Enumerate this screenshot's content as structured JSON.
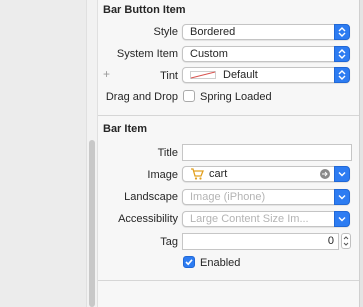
{
  "bar_button_item": {
    "title": "Bar Button Item",
    "style": {
      "label": "Style",
      "value": "Bordered"
    },
    "system_item": {
      "label": "System Item",
      "value": "Custom"
    },
    "tint": {
      "plus": "+",
      "label": "Tint",
      "value": "Default"
    },
    "drag_and_drop": {
      "label": "Drag and Drop",
      "option": "Spring Loaded",
      "checked": false
    }
  },
  "bar_item": {
    "title": "Bar Item",
    "title_field": {
      "label": "Title",
      "value": ""
    },
    "image": {
      "label": "Image",
      "value": "cart",
      "icon": "cart-icon"
    },
    "landscape": {
      "label": "Landscape",
      "placeholder": "Image (iPhone)"
    },
    "accessibility": {
      "label": "Accessibility",
      "placeholder": "Large Content Size Im..."
    },
    "tag": {
      "label": "Tag",
      "value": "0"
    },
    "enabled": {
      "label": "Enabled",
      "checked": true
    }
  },
  "colors": {
    "accent": "#2d7cf2",
    "tint_swatch": "#d9534f"
  }
}
